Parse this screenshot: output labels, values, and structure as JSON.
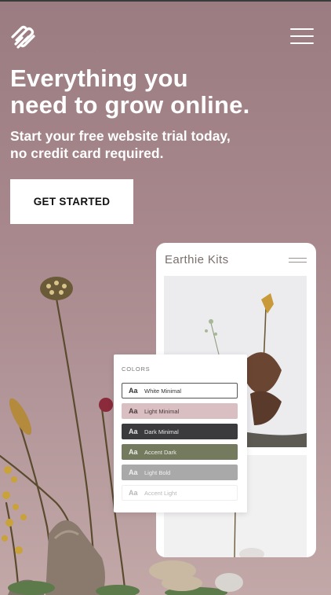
{
  "header": {
    "logo_icon": "squarespace-logo-icon",
    "menu_icon": "hamburger-menu-icon"
  },
  "hero": {
    "headline_line1": "Everything you",
    "headline_line2": "need to grow online.",
    "subhead_line1": "Start your free website trial today,",
    "subhead_line2": "no credit card required.",
    "cta_label": "GET STARTED"
  },
  "mockup": {
    "site_title": "Earthie Kits",
    "colors_title": "COLORS",
    "swatches": [
      {
        "aa": "Aa",
        "label": "White Minimal",
        "bg": "#ffffff",
        "fg": "#333333",
        "border": "#555555"
      },
      {
        "aa": "Aa",
        "label": "Light Minimal",
        "bg": "#d9bfc2",
        "fg": "#4a3a3c",
        "border": "#d9bfc2"
      },
      {
        "aa": "Aa",
        "label": "Dark Minimal",
        "bg": "#3b3b3d",
        "fg": "#e8e8e8",
        "border": "#3b3b3d"
      },
      {
        "aa": "Aa",
        "label": "Accent Dark",
        "bg": "#737a5e",
        "fg": "#eeeeea",
        "border": "#737a5e"
      },
      {
        "aa": "Aa",
        "label": "Light Bold",
        "bg": "#a9a9a9",
        "fg": "#f0f0f0",
        "border": "#a9a9a9"
      },
      {
        "aa": "Aa",
        "label": "Accent Light",
        "bg": "#ffffff",
        "fg": "#b8b8b8",
        "border": "#eeeeee"
      }
    ]
  },
  "colors": {
    "background_top": "#9a7c81",
    "background_bottom": "#c3a8a8",
    "text": "#ffffff"
  }
}
